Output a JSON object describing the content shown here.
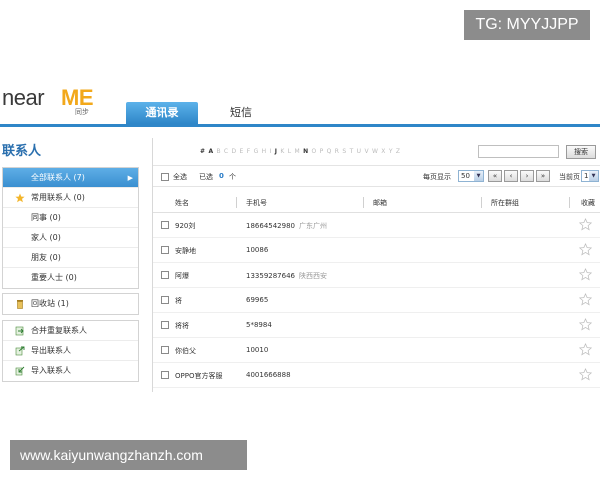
{
  "watermarks": {
    "top": "TG: MYYJJPP",
    "bottom": "www.kaiyunwangzhanzh.com"
  },
  "logo": {
    "near": "near",
    "me": "ME",
    "sub": "同步"
  },
  "tabs": [
    {
      "label": "通讯录",
      "active": true
    },
    {
      "label": "短信",
      "active": false
    }
  ],
  "sidebar": {
    "title": "联系人",
    "groups": [
      {
        "label": "全部联系人 (7)",
        "active": true
      },
      {
        "label": "常用联系人 (0)",
        "icon": "star-icon"
      },
      {
        "label": "同事 (0)"
      },
      {
        "label": "家人 (0)"
      },
      {
        "label": "朋友 (0)"
      },
      {
        "label": "重要人士 (0)"
      }
    ],
    "recycle": {
      "label": "回收站 (1)",
      "icon": "trash-icon"
    },
    "tools": [
      {
        "label": "合并重复联系人",
        "icon": "merge-icon"
      },
      {
        "label": "导出联系人",
        "icon": "export-icon"
      },
      {
        "label": "导入联系人",
        "icon": "import-icon"
      }
    ]
  },
  "alphabet": [
    "#",
    "A",
    "B",
    "C",
    "D",
    "E",
    "F",
    "G",
    "H",
    "I",
    "J",
    "K",
    "L",
    "M",
    "N",
    "O",
    "P",
    "Q",
    "R",
    "S",
    "T",
    "U",
    "V",
    "W",
    "X",
    "Y",
    "Z"
  ],
  "alphabet_active": [
    "#",
    "A",
    "J",
    "N"
  ],
  "search": {
    "button": "搜索",
    "value": ""
  },
  "toolbar": {
    "select_all": "全选",
    "selected_label": "已选",
    "selected_count": "0",
    "unit": "个",
    "per_page_label": "每页显示",
    "per_page": "50",
    "current_page_label": "当前页",
    "current_page": "1",
    "pager": [
      "«",
      "‹",
      "›",
      "»"
    ]
  },
  "columns": [
    "姓名",
    "手机号",
    "邮箱",
    "所在群组",
    "收藏"
  ],
  "contacts": [
    {
      "name": "920刘",
      "phone": "18664542980",
      "location": "广东广州"
    },
    {
      "name": "安静地",
      "phone": "10086",
      "location": ""
    },
    {
      "name": "阿爆",
      "phone": "13359287646",
      "location": "陕西西安"
    },
    {
      "name": "将",
      "phone": "69965",
      "location": ""
    },
    {
      "name": "将将",
      "phone": "5*8984",
      "location": ""
    },
    {
      "name": "你伯父",
      "phone": "10010",
      "location": ""
    },
    {
      "name": "OPPO官方客服",
      "phone": "4001666888",
      "location": ""
    }
  ]
}
